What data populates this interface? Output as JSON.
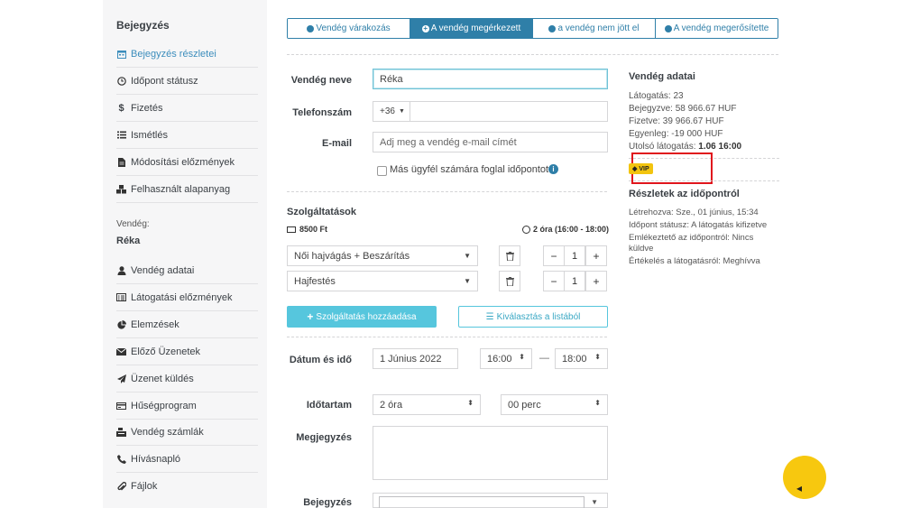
{
  "sidebar": {
    "heading": "Bejegyzés",
    "items": [
      {
        "label": "Bejegyzés részletei",
        "icon": "calendar-icon"
      },
      {
        "label": "Időpont státusz",
        "icon": "clock-icon"
      },
      {
        "label": "Fizetés",
        "icon": "dollar-icon"
      },
      {
        "label": "Ismétlés",
        "icon": "list-icon"
      },
      {
        "label": "Módosítási előzmények",
        "icon": "file-icon"
      },
      {
        "label": "Felhasznált alapanyag",
        "icon": "cubes-icon"
      }
    ],
    "guest_caption": "Vendég:",
    "guest_name": "Réka",
    "guest_items": [
      {
        "label": "Vendég adatai",
        "icon": "user-icon"
      },
      {
        "label": "Látogatási előzmények",
        "icon": "list-alt-icon"
      },
      {
        "label": "Elemzések",
        "icon": "pie-chart-icon"
      },
      {
        "label": "Előző Üzenetek",
        "icon": "envelope-icon"
      },
      {
        "label": "Üzenet küldés",
        "icon": "paper-plane-icon"
      },
      {
        "label": "Hűségprogram",
        "icon": "credit-card-icon"
      },
      {
        "label": "Vendég számlák",
        "icon": "cash-register-icon"
      },
      {
        "label": "Hívásnapló",
        "icon": "phone-icon"
      },
      {
        "label": "Fájlok",
        "icon": "paperclip-icon"
      }
    ]
  },
  "tabs": [
    {
      "label": "Vendég várakozás",
      "active": false,
      "icon": "clock-icon"
    },
    {
      "label": "A vendég megérkezett",
      "active": true,
      "icon": "plus-circle-icon"
    },
    {
      "label": "a vendég nem jött el",
      "active": false,
      "icon": "minus-circle-icon"
    },
    {
      "label": "A vendég megerősítette",
      "active": false,
      "icon": "check-circle-icon"
    }
  ],
  "form": {
    "name_label": "Vendég neve",
    "name_value": "Réka",
    "phone_label": "Telefonszám",
    "phone_prefix": "+36",
    "phone_value": "",
    "email_label": "E-mail",
    "email_placeholder": "Adj meg a vendég e-mail címét",
    "other_client_label": "Más ügyfél számára foglal időpontot",
    "services_title": "Szolgáltatások",
    "services_price": "8500 Ft",
    "services_time": "2 óra (16:00 - 18:00)",
    "services": [
      {
        "name": "Női hajvágás + Beszárítás",
        "qty": "1"
      },
      {
        "name": "Hajfestés",
        "qty": "1"
      }
    ],
    "add_service_label": "Szolgáltatás hozzáadása",
    "choose_list_label": "Kiválasztás a listából",
    "datetime_label": "Dátum és idő",
    "date_value": "1 Június 2022",
    "start_time": "16:00",
    "dash": "—",
    "end_time": "18:00",
    "duration_label": "Időtartam",
    "duration_hours": "2 óra",
    "duration_minutes": "00 perc",
    "note_label": "Megjegyzés",
    "entry_label": "Bejegyzés"
  },
  "guest_data": {
    "title": "Vendég adatai",
    "visits": "Látogatás: 23",
    "booked": "Bejegyzve: 58 966.67 HUF",
    "paid": "Fizetve: 39 966.67 HUF",
    "balance": "Egyenleg: -19 000 HUF",
    "last_visit_prefix": "Utolsó látogatás:",
    "last_visit_value": "1.06 16:00",
    "vip_label": "VIP"
  },
  "appointment_details": {
    "title": "Részletek az időpontról",
    "created": "Létrehozva: Sze., 01 június, 15:34",
    "status": "Időpont státusz: A látogatás kifizetve",
    "reminder_line1": "Emlékeztető az időpontról: Nincs",
    "reminder_line2": "küldve",
    "rating": "Értékelés a látogatásról: Meghívva"
  },
  "colors": {
    "primary": "#2f7fa8",
    "teal": "#56c6dd",
    "vip": "#f2c40f",
    "highlight": "#e0161d",
    "fab": "#f7c80f"
  }
}
